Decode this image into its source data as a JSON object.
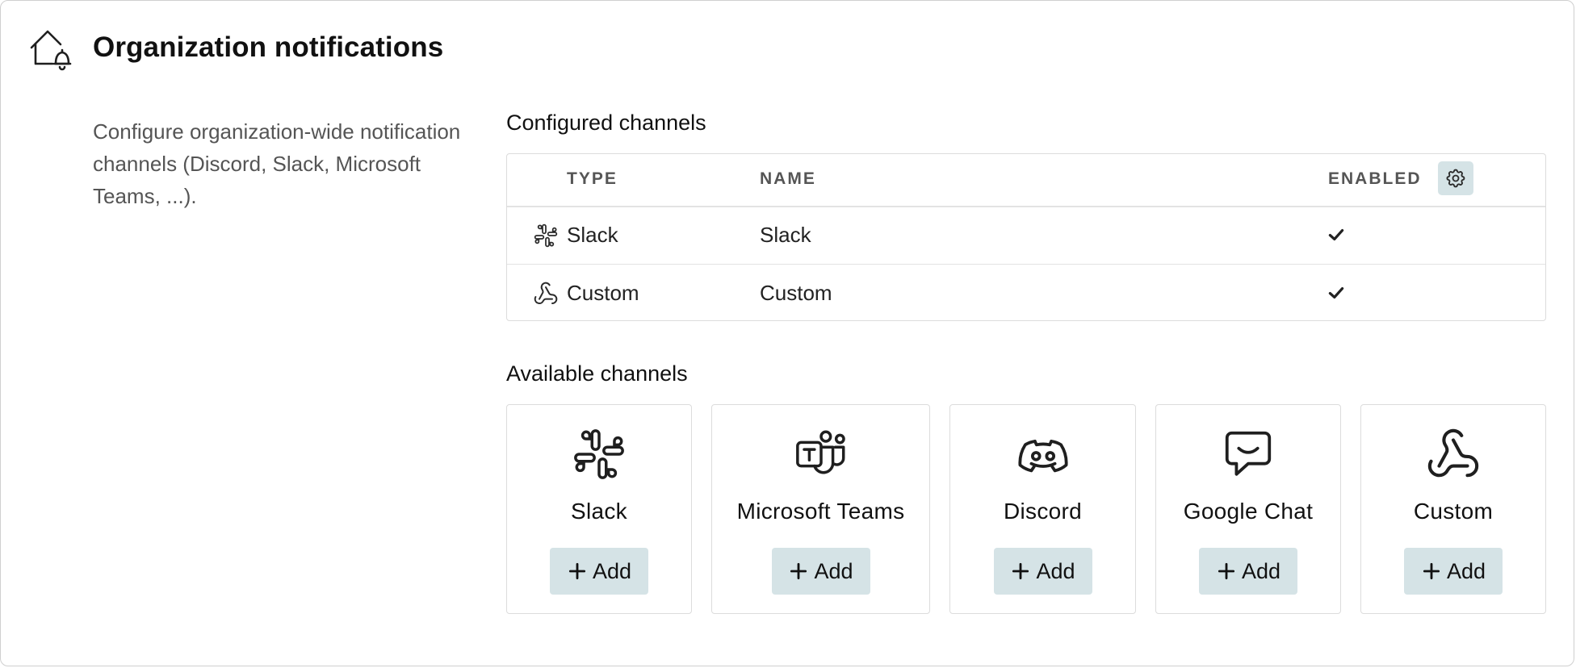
{
  "header": {
    "title": "Organization notifications",
    "icon": "house-bell-icon",
    "description": "Configure organization-wide notification channels (Discord, Slack, Microsoft Teams, ...)."
  },
  "configured": {
    "heading": "Configured channels",
    "columns": {
      "type": "TYPE",
      "name": "NAME",
      "enabled": "ENABLED"
    },
    "settings_icon": "gear-icon",
    "rows": [
      {
        "type": "Slack",
        "name": "Slack",
        "enabled": true,
        "icon": "slack-icon"
      },
      {
        "type": "Custom",
        "name": "Custom",
        "enabled": true,
        "icon": "webhook-icon"
      }
    ]
  },
  "available": {
    "heading": "Available channels",
    "add_label": "Add",
    "channels": [
      {
        "name": "Slack",
        "icon": "slack-icon"
      },
      {
        "name": "Microsoft Teams",
        "icon": "microsoft-teams-icon"
      },
      {
        "name": "Discord",
        "icon": "discord-icon"
      },
      {
        "name": "Google Chat",
        "icon": "google-chat-icon"
      },
      {
        "name": "Custom",
        "icon": "webhook-icon"
      }
    ]
  },
  "colors": {
    "button_bg": "#d5e3e6",
    "border": "#dcdcdc",
    "muted_text": "#555555"
  }
}
